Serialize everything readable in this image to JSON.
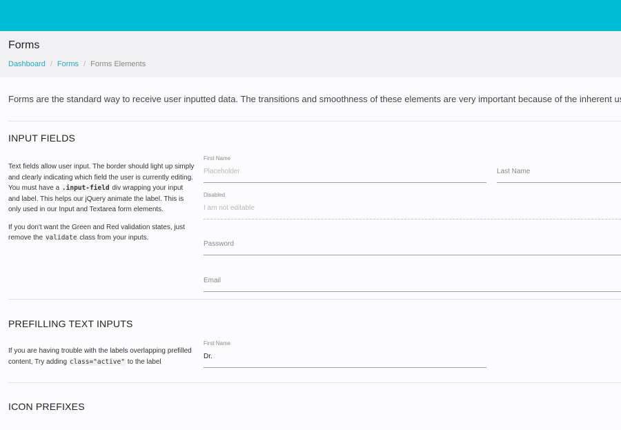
{
  "header": {
    "title": "Forms",
    "breadcrumb": [
      "Dashboard",
      "Forms",
      "Forms Elements"
    ]
  },
  "intro": "Forms are the standard way to receive user inputted data. The transitions and smoothness of these elements are very important because of the inherent us",
  "sections": {
    "input_fields": {
      "heading": "INPUT FIELDS",
      "desc1_a": "Text fields allow user input. The border should light up simply and clearly indicating which field the user is currently editing. You must have a ",
      "desc1_code": ".input-field",
      "desc1_b": " div wrapping your input and label. This helps our jQuery animate the label. This is only used in our Input and Textarea form elements.",
      "desc2_a": "If you don't want the Green and Red validation states, just remove the ",
      "desc2_code": "validate",
      "desc2_b": " class from your inputs.",
      "first_name_label": "First Name",
      "first_name_placeholder": "Placeholder",
      "last_name_label": "Last Name",
      "disabled_label": "Disabled",
      "disabled_value": "I am not editable",
      "password_label": "Password",
      "email_label": "Email"
    },
    "prefilling": {
      "heading": "PREFILLING TEXT INPUTS",
      "desc_a": "If you are having trouble with the labels overlapping prefilled content, Try adding ",
      "desc_code": "class=\"active\"",
      "desc_b": " to the label",
      "first_name_label": "First Name",
      "first_name_value": "Dr."
    },
    "icon_prefixes": {
      "heading": "ICON PREFIXES"
    }
  },
  "colors": {
    "topbar": "#00bcd4",
    "link": "#26a9c4"
  }
}
